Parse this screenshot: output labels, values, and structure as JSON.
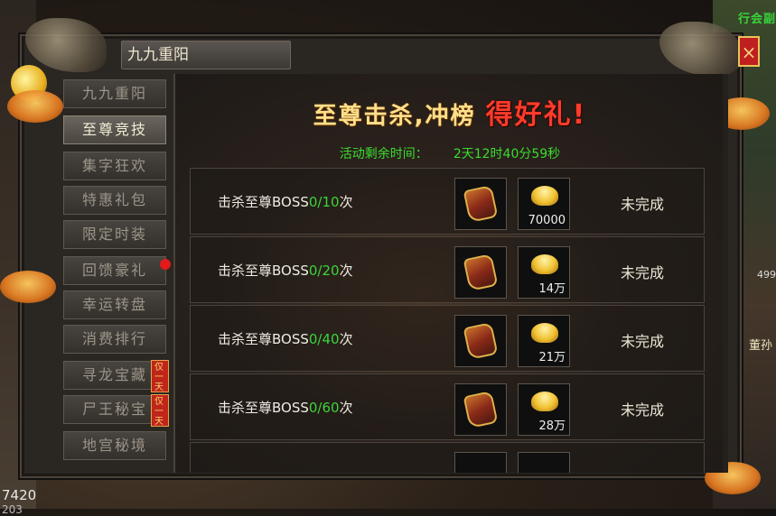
{
  "window": {
    "title": "九九重阳",
    "close_label": "×"
  },
  "background": {
    "guild_tag": "行会副",
    "coords": "7420",
    "coords2": "203",
    "side_hp": "499",
    "side_name": "董孙"
  },
  "sidebar": {
    "items": [
      {
        "label": "九九重阳"
      },
      {
        "label": "至尊竞技"
      },
      {
        "label": "集字狂欢"
      },
      {
        "label": "特惠礼包"
      },
      {
        "label": "限定时装"
      },
      {
        "label": "回馈豪礼"
      },
      {
        "label": "幸运转盘"
      },
      {
        "label": "消费排行"
      },
      {
        "label": "寻龙宝藏"
      },
      {
        "label": "尸王秘宝"
      },
      {
        "label": "地宫秘境"
      }
    ],
    "active_index": 1,
    "ribbon_text": "仅一天"
  },
  "banner": {
    "part1": "至尊击杀,冲榜",
    "part2": "得好礼!"
  },
  "timer": {
    "label": "活动剩余时间：",
    "value": "2天12时40分59秒"
  },
  "tasks": [
    {
      "prefix": "击杀至尊BOSS",
      "progress": "0/10",
      "suffix": "次",
      "reward_qty": "70000",
      "status": "未完成"
    },
    {
      "prefix": "击杀至尊BOSS",
      "progress": "0/20",
      "suffix": "次",
      "reward_qty": "14万",
      "status": "未完成"
    },
    {
      "prefix": "击杀至尊BOSS",
      "progress": "0/40",
      "suffix": "次",
      "reward_qty": "21万",
      "status": "未完成"
    },
    {
      "prefix": "击杀至尊BOSS",
      "progress": "0/60",
      "suffix": "次",
      "reward_qty": "28万",
      "status": "未完成"
    }
  ]
}
